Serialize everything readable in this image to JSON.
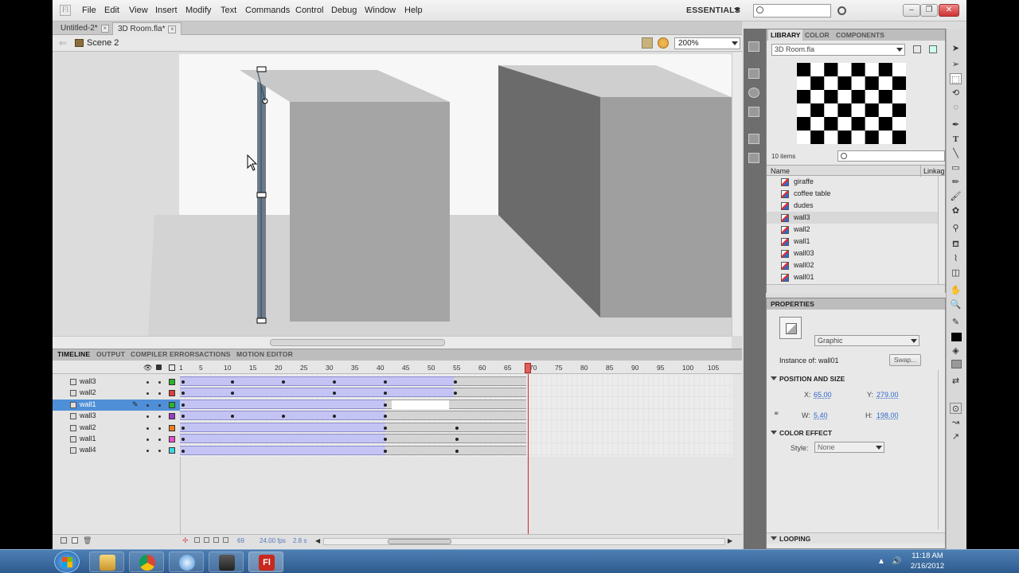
{
  "menubar": {
    "items": [
      "File",
      "Edit",
      "View",
      "Insert",
      "Modify",
      "Text",
      "Commands",
      "Control",
      "Debug",
      "Window",
      "Help"
    ],
    "workspace": "ESSENTIALS"
  },
  "doc_tabs": [
    {
      "label": "Untitled-2*",
      "active": false
    },
    {
      "label": "3D Room.fla*",
      "active": true
    }
  ],
  "editbar": {
    "scene": "Scene 2",
    "zoom": "200%"
  },
  "timeline": {
    "tabs": [
      "TIMELINE",
      "OUTPUT",
      "COMPILER ERRORS",
      "ACTIONS",
      "MOTION EDITOR"
    ],
    "frame_numbers": [
      "1",
      "5",
      "10",
      "15",
      "20",
      "25",
      "30",
      "35",
      "40",
      "45",
      "50",
      "55",
      "60",
      "65",
      "70",
      "75",
      "80",
      "85",
      "90",
      "95",
      "100",
      "105"
    ],
    "playhead_frame": 69,
    "layers": [
      {
        "name": "wall3",
        "color": "#2bb52b",
        "selected": false
      },
      {
        "name": "wall2",
        "color": "#e03c3c",
        "selected": false
      },
      {
        "name": "wall1",
        "color": "#2bb52b",
        "selected": true
      },
      {
        "name": "wall3",
        "color": "#9b3cc8",
        "selected": false
      },
      {
        "name": "wall2",
        "color": "#f07c1c",
        "selected": false
      },
      {
        "name": "wall1",
        "color": "#e850d0",
        "selected": false
      },
      {
        "name": "wall4",
        "color": "#3cd8e0",
        "selected": false
      }
    ],
    "footer": {
      "frame": "69",
      "fps": "24.00 fps",
      "time": "2.8 s"
    }
  },
  "library": {
    "tabs": [
      "LIBRARY",
      "COLOR",
      "COMPONENTS"
    ],
    "document": "3D Room.fla",
    "count": "10 items",
    "columns": [
      "Name",
      "Linkag"
    ],
    "items": [
      {
        "name": "giraffe",
        "selected": false
      },
      {
        "name": "coffee table",
        "selected": false
      },
      {
        "name": "dudes",
        "selected": false
      },
      {
        "name": "wall3",
        "selected": true
      },
      {
        "name": "wall2",
        "selected": false
      },
      {
        "name": "wall1",
        "selected": false
      },
      {
        "name": "wall03",
        "selected": false
      },
      {
        "name": "wall02",
        "selected": false
      },
      {
        "name": "wall01",
        "selected": false
      }
    ]
  },
  "properties": {
    "title": "PROPERTIES",
    "type": "Graphic",
    "instance_label": "Instance of:",
    "instance": "wall01",
    "swap": "Swap...",
    "pos_section": "POSITION AND SIZE",
    "x_label": "X:",
    "x": "65.00",
    "y_label": "Y:",
    "y": "279.00",
    "w_label": "W:",
    "w": "5.40",
    "h_label": "H:",
    "h": "198.00",
    "color_section": "COLOR EFFECT",
    "style_label": "Style:",
    "style": "None",
    "looping_section": "LOOPING"
  },
  "taskbar": {
    "time": "11:18 AM",
    "date": "2/16/2012"
  },
  "colors": {
    "accent": "#4f8fd8",
    "tween": "#c4c4f4",
    "playhead": "#e02020"
  }
}
